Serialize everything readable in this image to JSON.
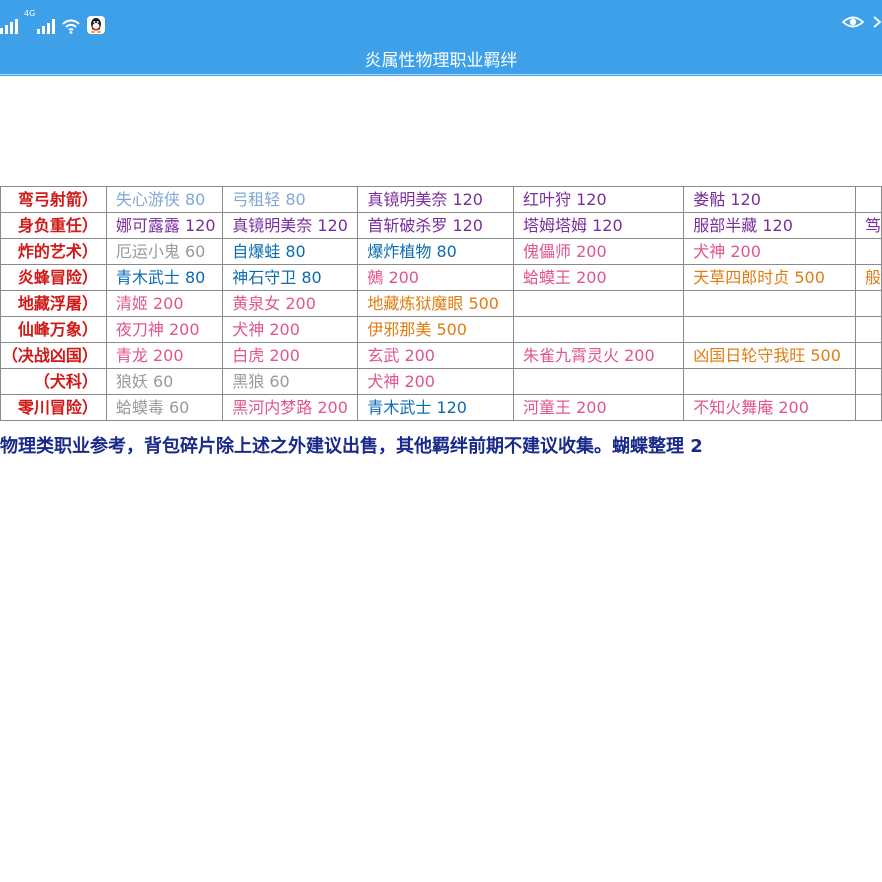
{
  "status_bar": {
    "signal1_label": "",
    "signal2_label": "4G",
    "icons": [
      "signal-icon",
      "signal-4g-icon",
      "wifi-icon",
      "qq-icon",
      "eye-icon",
      "eye-icon-partial"
    ]
  },
  "app": {
    "title": "炎属性物理职业羁绊"
  },
  "table": {
    "rows": [
      {
        "category": "弯弓射箭）",
        "cells": [
          {
            "text": "失心游侠 80",
            "color": "lightblue"
          },
          {
            "text": "弓租轻 80",
            "color": "lightblue"
          },
          {
            "text": "真镜明美奈 120",
            "color": "purple"
          },
          {
            "text": "红叶狩 120",
            "color": "purple"
          },
          {
            "text": "娄骷 120",
            "color": "purple"
          },
          {
            "text": "",
            "color": "purple"
          }
        ]
      },
      {
        "category": "身负重任）",
        "cells": [
          {
            "text": "娜可露露 120",
            "color": "purple"
          },
          {
            "text": "真镜明美奈 120",
            "color": "purple"
          },
          {
            "text": "首斩破杀罗 120",
            "color": "purple"
          },
          {
            "text": "塔姆塔姆 120",
            "color": "purple"
          },
          {
            "text": "服部半藏 120",
            "color": "purple"
          },
          {
            "text": "笃",
            "color": "purple"
          }
        ]
      },
      {
        "category": "炸的艺术）",
        "cells": [
          {
            "text": "厄运小鬼 60",
            "color": "grey"
          },
          {
            "text": "自爆蛙 80",
            "color": "blue"
          },
          {
            "text": "爆炸植物 80",
            "color": "blue"
          },
          {
            "text": "傀儡师 200",
            "color": "pink"
          },
          {
            "text": "犬神 200",
            "color": "pink"
          },
          {
            "text": "",
            "color": "pink"
          }
        ]
      },
      {
        "category": "炎蜂冒险）",
        "cells": [
          {
            "text": "青木武士 80",
            "color": "blue"
          },
          {
            "text": "神石守卫 80",
            "color": "blue"
          },
          {
            "text": "鵺 200",
            "color": "pink"
          },
          {
            "text": "蛤蟆王 200",
            "color": "pink"
          },
          {
            "text": "天草四郎时贞 500",
            "color": "orange"
          },
          {
            "text": "般",
            "color": "orange"
          }
        ]
      },
      {
        "category": "地藏浮屠）",
        "cells": [
          {
            "text": "清姬 200",
            "color": "pink"
          },
          {
            "text": "黄泉女 200",
            "color": "pink"
          },
          {
            "text": "地藏炼狱魔眼 500",
            "color": "orange"
          },
          {
            "text": "",
            "color": "pink"
          },
          {
            "text": "",
            "color": "pink"
          },
          {
            "text": "",
            "color": "pink"
          }
        ]
      },
      {
        "category": "仙峰万象）",
        "cells": [
          {
            "text": "夜刀神 200",
            "color": "pink"
          },
          {
            "text": "犬神 200",
            "color": "pink"
          },
          {
            "text": "伊邪那美 500",
            "color": "orange"
          },
          {
            "text": "",
            "color": "pink"
          },
          {
            "text": "",
            "color": "pink"
          },
          {
            "text": "",
            "color": "pink"
          }
        ]
      },
      {
        "category": "（决战凶国）",
        "cells": [
          {
            "text": "青龙 200",
            "color": "pink"
          },
          {
            "text": "白虎 200",
            "color": "pink"
          },
          {
            "text": "玄武 200",
            "color": "pink"
          },
          {
            "text": "朱雀九霄灵火 200",
            "color": "pink"
          },
          {
            "text": "凶国日轮守我旺 500",
            "color": "orange"
          },
          {
            "text": "",
            "color": "pink"
          }
        ]
      },
      {
        "category": "（犬科）",
        "cells": [
          {
            "text": "狼妖 60",
            "color": "grey"
          },
          {
            "text": "黑狼 60",
            "color": "grey"
          },
          {
            "text": "犬神 200",
            "color": "pink"
          },
          {
            "text": "",
            "color": "pink"
          },
          {
            "text": "",
            "color": "pink"
          },
          {
            "text": "",
            "color": "pink"
          }
        ]
      },
      {
        "category": "零川冒险）",
        "cells": [
          {
            "text": "蛤蟆毒 60",
            "color": "grey"
          },
          {
            "text": "黑河内梦路 200",
            "color": "pink"
          },
          {
            "text": "青木武士 120",
            "color": "blue"
          },
          {
            "text": "河童王 200",
            "color": "pink"
          },
          {
            "text": "不知火舞庵 200",
            "color": "pink"
          },
          {
            "text": "",
            "color": "pink"
          }
        ]
      }
    ]
  },
  "note": {
    "text": "物理类职业参考，背包碎片除上述之外建议出售，其他羁绊前期不建议收集。蝴蝶整理 2"
  },
  "colors": {
    "header_bg": "#3ea0e8",
    "category_red": "#d01a1a",
    "note_navy": "#1a2a8a"
  }
}
